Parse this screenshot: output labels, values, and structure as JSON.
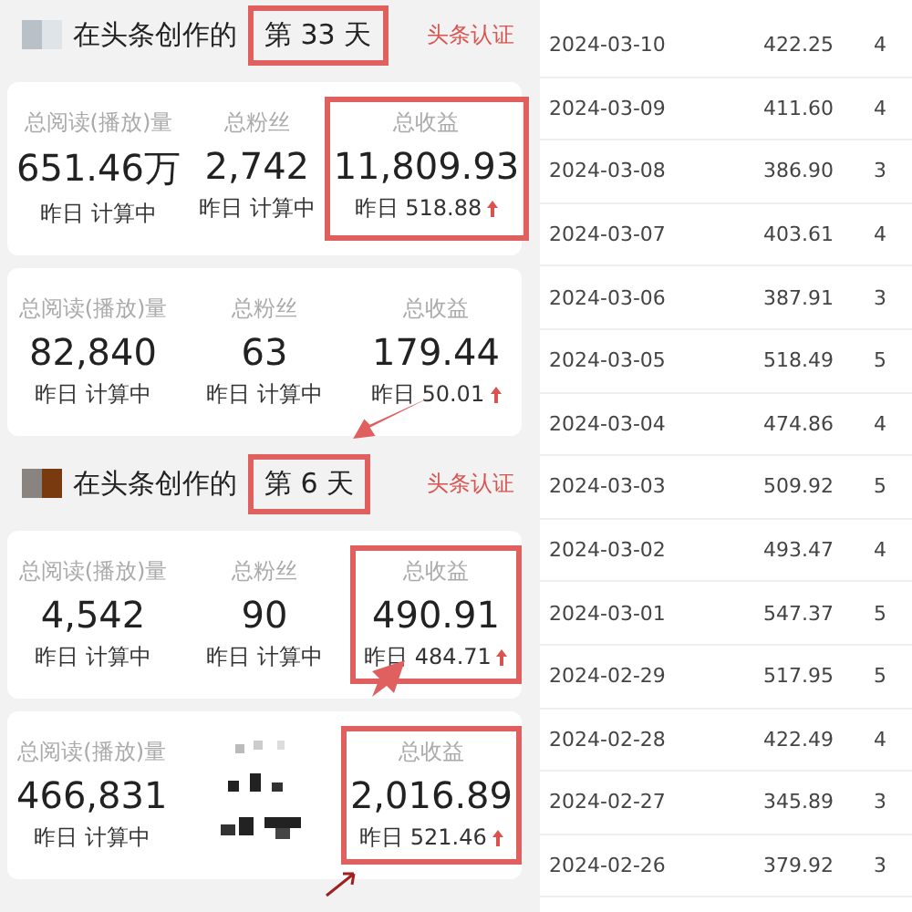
{
  "accounts": [
    {
      "header": {
        "prefix": "在头条创作的",
        "days": "第 33 天",
        "days_highlighted": true,
        "badge": "头条认证"
      },
      "stats": [
        {
          "kind": "text",
          "label": "总阅读(播放)量",
          "value": "651.46万",
          "sub": "昨日 计算中",
          "rising": false,
          "highlighted": false
        },
        {
          "kind": "text",
          "label": "总粉丝",
          "value": "2,742",
          "sub": "昨日 计算中",
          "rising": false,
          "highlighted": false
        },
        {
          "kind": "text",
          "label": "总收益",
          "value": "11,809.93",
          "sub": "昨日 518.88",
          "rising": true,
          "highlighted": true
        }
      ]
    },
    {
      "stats": [
        {
          "kind": "text",
          "label": "总阅读(播放)量",
          "value": "82,840",
          "sub": "昨日 计算中",
          "rising": false,
          "highlighted": false
        },
        {
          "kind": "text",
          "label": "总粉丝",
          "value": "63",
          "sub": "昨日 计算中",
          "rising": false,
          "highlighted": false
        },
        {
          "kind": "text",
          "label": "总收益",
          "value": "179.44",
          "sub": "昨日 50.01",
          "rising": true,
          "highlighted": false
        }
      ]
    },
    {
      "header": {
        "prefix": "在头条创作的",
        "days": "第 6 天",
        "days_highlighted": true,
        "badge": "头条认证"
      },
      "stats": [
        {
          "kind": "text",
          "label": "总阅读(播放)量",
          "value": "4,542",
          "sub": "昨日 计算中",
          "rising": false,
          "highlighted": false
        },
        {
          "kind": "text",
          "label": "总粉丝",
          "value": "90",
          "sub": "昨日 计算中",
          "rising": false,
          "highlighted": false
        },
        {
          "kind": "text",
          "label": "总收益",
          "value": "490.91",
          "sub": "昨日 484.71",
          "rising": true,
          "highlighted": true
        }
      ]
    },
    {
      "stats": [
        {
          "kind": "text",
          "label": "总阅读(播放)量",
          "value": "466,831",
          "sub": "昨日 计算中",
          "rising": false,
          "highlighted": false
        },
        {
          "kind": "redacted"
        },
        {
          "kind": "text",
          "label": "总收益",
          "value": "2,016.89",
          "sub": "昨日 521.46",
          "rising": true,
          "highlighted": true
        }
      ]
    }
  ],
  "table": {
    "rows": [
      {
        "date": "2024-03-10",
        "amount": "422.25",
        "column_3": "4"
      },
      {
        "date": "2024-03-09",
        "amount": "411.60",
        "column_3": "4"
      },
      {
        "date": "2024-03-08",
        "amount": "386.90",
        "column_3": "3"
      },
      {
        "date": "2024-03-07",
        "amount": "403.61",
        "column_3": "4"
      },
      {
        "date": "2024-03-06",
        "amount": "387.91",
        "column_3": "3"
      },
      {
        "date": "2024-03-05",
        "amount": "518.49",
        "column_3": "5"
      },
      {
        "date": "2024-03-04",
        "amount": "474.86",
        "column_3": "4"
      },
      {
        "date": "2024-03-03",
        "amount": "509.92",
        "column_3": "5"
      },
      {
        "date": "2024-03-02",
        "amount": "493.47",
        "column_3": "4"
      },
      {
        "date": "2024-03-01",
        "amount": "547.37",
        "column_3": "5"
      },
      {
        "date": "2024-02-29",
        "amount": "517.95",
        "column_3": "5"
      },
      {
        "date": "2024-02-28",
        "amount": "422.49",
        "column_3": "4"
      },
      {
        "date": "2024-02-27",
        "amount": "345.89",
        "column_3": "3"
      },
      {
        "date": "2024-02-26",
        "amount": "379.92",
        "column_3": "3"
      }
    ]
  }
}
